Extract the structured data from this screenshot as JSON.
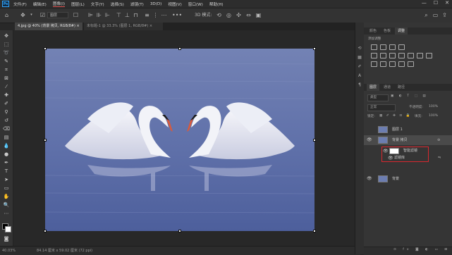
{
  "menu": [
    "文件(F)",
    "编辑(E)",
    "图像(I)",
    "图层(L)",
    "文字(Y)",
    "选择(S)",
    "滤镜(T)",
    "3D(D)",
    "视图(V)",
    "窗口(W)",
    "帮助(H)"
  ],
  "window_controls": [
    "—",
    "☐",
    "✕"
  ],
  "options": {
    "sample_label": "图层",
    "show_transform": "显示变换控件",
    "mode_3d": "3D 模式:"
  },
  "tabs": [
    {
      "label": "4.jpg @ 40% (背景 拷贝, RGB/8#) ×"
    },
    {
      "label": "未标题-1 @ 33.3% (图层 1, RGB/8#) ×"
    }
  ],
  "status": {
    "zoom": "40.03%",
    "doc_size": "84.14 厘米 x 59.02 厘米 (72 ppi)"
  },
  "panels": {
    "top_tabs": [
      "颜色",
      "色板",
      "调整"
    ],
    "adjust_hint": "添加调整",
    "layer_tabs": [
      "图层",
      "通道",
      "路径"
    ],
    "search_kind": "类型",
    "blend_mode": "正常",
    "opacity_label": "不透明度:",
    "opacity": "100%",
    "lock_label": "锁定:",
    "fill_label": "填充:",
    "fill": "100%"
  },
  "layers": {
    "layer1": "图层 1",
    "copy": "背景 拷贝",
    "smart_filters": "智能滤镜",
    "filter_item": "滤镜库",
    "background": "背景"
  },
  "colors": {
    "accent": "#31a8ff",
    "highlight_box": "#d9272e",
    "selected_row": "#4a4a4a"
  }
}
